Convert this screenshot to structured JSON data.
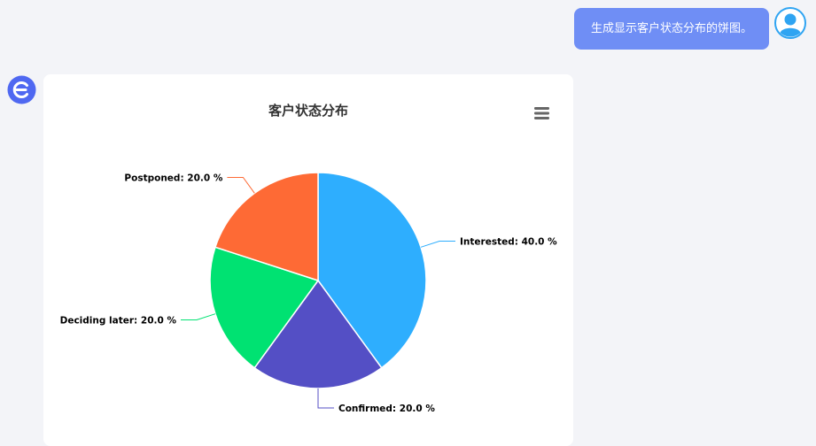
{
  "conversation": {
    "user_message": "生成显示客户状态分布的饼图。"
  },
  "icons": {
    "user_avatar": "user-avatar-icon",
    "bot_avatar": "bot-logo-icon",
    "chart_menu": "hamburger-menu-icon"
  },
  "colors": {
    "user_bubble": "#6f8ef5",
    "bot_logo": "#4f68f1",
    "avatar_blue": "#2fa4f2"
  },
  "chart_data": {
    "type": "pie",
    "title": "客户状态分布",
    "slices": [
      {
        "label": "Interested",
        "value": 40.0,
        "display": "Interested: 40.0 %",
        "color": "#2eaefe"
      },
      {
        "label": "Confirmed",
        "value": 20.0,
        "display": "Confirmed: 20.0 %",
        "color": "#544fc5"
      },
      {
        "label": "Deciding later",
        "value": 20.0,
        "display": "Deciding later: 20.0 %",
        "color": "#00e272"
      },
      {
        "label": "Postponed",
        "value": 20.0,
        "display": "Postponed: 20.0 %",
        "color": "#fe6a35"
      }
    ]
  }
}
